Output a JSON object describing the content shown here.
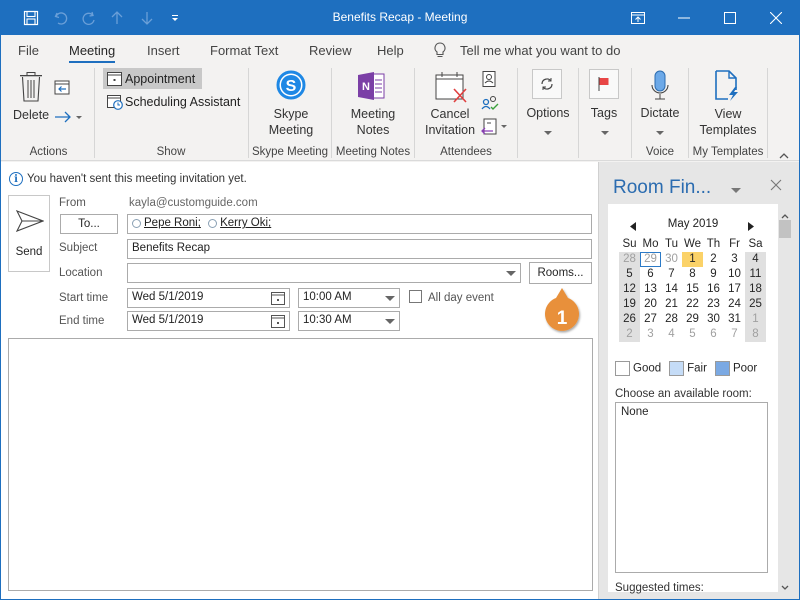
{
  "window": {
    "title": "Benefits Recap  -  Meeting",
    "controls": [
      "ribbon-display-options",
      "minimize",
      "maximize",
      "close"
    ]
  },
  "quick_access": [
    "save",
    "undo",
    "redo",
    "previous-item",
    "next-item",
    "customize"
  ],
  "tabs": [
    {
      "label": "File"
    },
    {
      "label": "Meeting",
      "active": true
    },
    {
      "label": "Insert"
    },
    {
      "label": "Format Text"
    },
    {
      "label": "Review"
    },
    {
      "label": "Help"
    }
  ],
  "tell_me": "Tell me what you want to do",
  "ribbon": {
    "actions": {
      "delete": "Delete",
      "group": "Actions"
    },
    "show": {
      "appointment": "Appointment",
      "scheduling": "Scheduling Assistant",
      "group": "Show"
    },
    "skype": {
      "line1": "Skype",
      "line2": "Meeting",
      "group": "Skype Meeting"
    },
    "notes": {
      "line1": "Meeting",
      "line2": "Notes",
      "group": "Meeting Notes"
    },
    "attendees": {
      "line1": "Cancel",
      "line2": "Invitation",
      "group": "Attendees"
    },
    "options": {
      "label": "Options"
    },
    "tags": {
      "label": "Tags"
    },
    "voice": {
      "label": "Dictate",
      "group": "Voice"
    },
    "templates": {
      "line1": "View",
      "line2": "Templates",
      "group": "My Templates"
    }
  },
  "compose": {
    "info": "You haven't sent this meeting invitation yet.",
    "send": "Send",
    "from_label": "From",
    "from_value": "kayla@customguide.com",
    "to_button": "To...",
    "recipients": [
      "Pepe Roni;",
      "Kerry Oki;"
    ],
    "subject_label": "Subject",
    "subject_value": "Benefits Recap",
    "location_label": "Location",
    "location_value": "",
    "rooms_button": "Rooms...",
    "start_label": "Start time",
    "start_date": "Wed 5/1/2019",
    "start_time": "10:00 AM",
    "end_label": "End time",
    "end_date": "Wed 5/1/2019",
    "end_time": "10:30 AM",
    "all_day": "All day event",
    "all_day_checked": false,
    "callout": "1"
  },
  "room_finder": {
    "title": "Room Fin...",
    "month": "May 2019",
    "weekdays": [
      "Su",
      "Mo",
      "Tu",
      "We",
      "Th",
      "Fr",
      "Sa"
    ],
    "weeks": [
      [
        "28",
        "29",
        "30",
        "1",
        "2",
        "3",
        "4"
      ],
      [
        "5",
        "6",
        "7",
        "8",
        "9",
        "10",
        "11"
      ],
      [
        "12",
        "13",
        "14",
        "15",
        "16",
        "17",
        "18"
      ],
      [
        "19",
        "20",
        "21",
        "22",
        "23",
        "24",
        "25"
      ],
      [
        "26",
        "27",
        "28",
        "29",
        "30",
        "31",
        "1"
      ],
      [
        "2",
        "3",
        "4",
        "5",
        "6",
        "7",
        "8"
      ]
    ],
    "today": "1",
    "legend": [
      {
        "label": "Good",
        "color": "#ffffff"
      },
      {
        "label": "Fair",
        "color": "#c5dcf7"
      },
      {
        "label": "Poor",
        "color": "#7ba9e3"
      }
    ],
    "choose_room_label": "Choose an available room:",
    "rooms": [
      "None"
    ],
    "suggested_label": "Suggested times:"
  },
  "colors": {
    "accent": "#1e6fbf",
    "today": "#fbd268",
    "callout": "#e8903a"
  }
}
